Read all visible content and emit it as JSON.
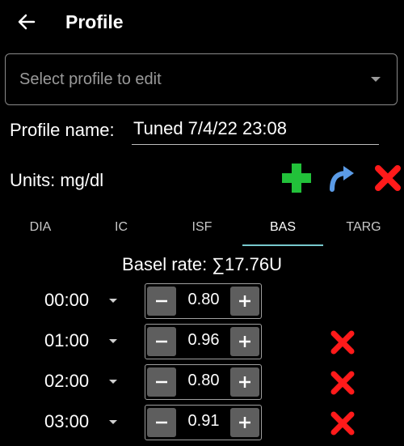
{
  "header": {
    "title": "Profile",
    "back_icon": "arrow-left-icon"
  },
  "profile_select": {
    "placeholder": "Select profile to edit"
  },
  "profile_name": {
    "label": "Profile name:",
    "value": "Tuned 7/4/22 23:08"
  },
  "units": {
    "label": "Units: mg/dl"
  },
  "actions": {
    "add_icon": "plus-icon",
    "redo_icon": "redo-icon",
    "delete_icon": "close-icon",
    "add_color": "#22c13a",
    "redo_color": "#5b9be6",
    "delete_color": "#ff1a1a"
  },
  "tabs": [
    {
      "label": "DIA"
    },
    {
      "label": "IC"
    },
    {
      "label": "ISF"
    },
    {
      "label": "BAS",
      "active": true
    },
    {
      "label": "TARG"
    }
  ],
  "basal": {
    "text": "Basel rate: ∑17.76U"
  },
  "rows": [
    {
      "time": "00:00",
      "value": "0.80",
      "removable": false
    },
    {
      "time": "01:00",
      "value": "0.96",
      "removable": true
    },
    {
      "time": "02:00",
      "value": "0.80",
      "removable": true
    },
    {
      "time": "03:00",
      "value": "0.91",
      "removable": true
    }
  ],
  "colors": {
    "accent": "#77c8cd",
    "background": "#000000"
  }
}
